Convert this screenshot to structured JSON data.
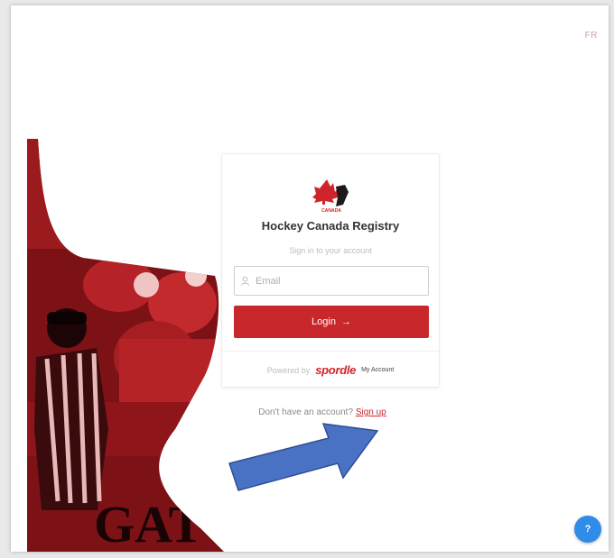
{
  "header": {
    "language_toggle": "FR"
  },
  "card": {
    "logo_caption": "CANADA",
    "title": "Hockey Canada Registry",
    "subtitle": "Sign in to your account",
    "email_placeholder": "Email",
    "login_label": "Login",
    "login_arrow": "→",
    "powered_by": "Powered by",
    "brand": "spordle",
    "brand_suffix": "My Account"
  },
  "signup": {
    "prompt": "Don't have an account?",
    "link": "Sign up"
  },
  "hero_banner_text": "GATC",
  "help": {
    "label": "?"
  },
  "colors": {
    "primary": "#c8282c",
    "help": "#2f8ce8",
    "annotation_arrow": "#4a72c4"
  },
  "icons": {
    "email": "person-icon",
    "arrow": "arrow-right-icon",
    "logo": "hockey-canada-maple-leaf-logo"
  }
}
